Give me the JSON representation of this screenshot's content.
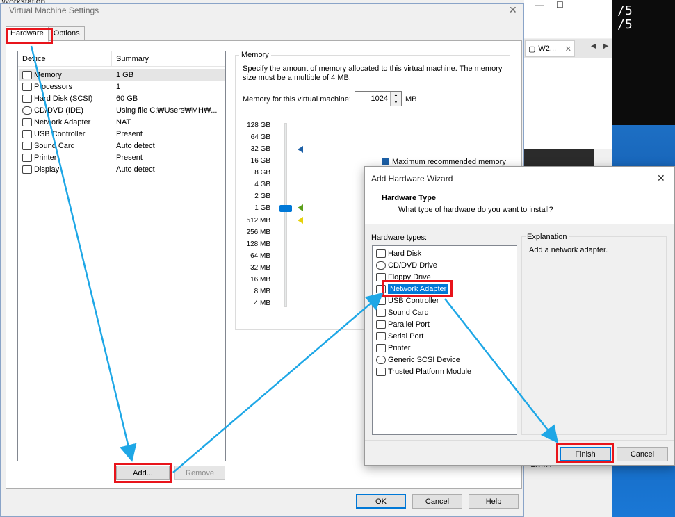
{
  "background": {
    "app_title": "Workstation",
    "console_lines": [
      "/5",
      "/5"
    ],
    "tab_label": "W2...",
    "file_hint": "-2.vmx"
  },
  "dialog": {
    "title": "Virtual Machine Settings",
    "tabs": [
      "Hardware",
      "Options"
    ],
    "device_header": "Device",
    "summary_header": "Summary",
    "devices": [
      {
        "name": "Memory",
        "summary": "1 GB",
        "icon": "memory-icon"
      },
      {
        "name": "Processors",
        "summary": "1",
        "icon": "processor-icon"
      },
      {
        "name": "Hard Disk (SCSI)",
        "summary": "60 GB",
        "icon": "hard-disk-icon"
      },
      {
        "name": "CD/DVD (IDE)",
        "summary": "Using file C:₩Users₩MH₩...",
        "icon": "cd-dvd-icon"
      },
      {
        "name": "Network Adapter",
        "summary": "NAT",
        "icon": "network-adapter-icon"
      },
      {
        "name": "USB Controller",
        "summary": "Present",
        "icon": "usb-icon"
      },
      {
        "name": "Sound Card",
        "summary": "Auto detect",
        "icon": "sound-icon"
      },
      {
        "name": "Printer",
        "summary": "Present",
        "icon": "printer-icon"
      },
      {
        "name": "Display",
        "summary": "Auto detect",
        "icon": "display-icon"
      }
    ],
    "add_label": "Add...",
    "remove_label": "Remove",
    "ok_label": "OK",
    "cancel_label": "Cancel",
    "help_label": "Help",
    "memory": {
      "group_label": "Memory",
      "description": "Specify the amount of memory allocated to this virtual machine. The memory size must be a multiple of 4 MB.",
      "for_label": "Memory for this virtual machine:",
      "value": "1024",
      "unit": "MB",
      "scale": [
        "128 GB",
        "64 GB",
        "32 GB",
        "16 GB",
        "8 GB",
        "4 GB",
        "2 GB",
        "1 GB",
        "512 MB",
        "256 MB",
        "128 MB",
        "64 MB",
        "32 MB",
        "16 MB",
        "8 MB",
        "4 MB"
      ],
      "max_recommended_label": "Maximum recommended memory",
      "colors": {
        "max_marker": "#1c5fa6",
        "recommended_marker": "#5a9e1a",
        "guest_marker": "#e6d10a"
      }
    }
  },
  "wizard": {
    "title": "Add Hardware Wizard",
    "heading": "Hardware Type",
    "subheading": "What type of hardware do you want to install?",
    "types_label": "Hardware types:",
    "types": [
      {
        "name": "Hard Disk",
        "icon": "hard-disk-icon"
      },
      {
        "name": "CD/DVD Drive",
        "icon": "cd-dvd-icon"
      },
      {
        "name": "Floppy Drive",
        "icon": "floppy-icon"
      },
      {
        "name": "Network Adapter",
        "icon": "network-adapter-icon"
      },
      {
        "name": "USB Controller",
        "icon": "usb-icon"
      },
      {
        "name": "Sound Card",
        "icon": "sound-icon"
      },
      {
        "name": "Parallel Port",
        "icon": "parallel-port-icon"
      },
      {
        "name": "Serial Port",
        "icon": "serial-port-icon"
      },
      {
        "name": "Printer",
        "icon": "printer-icon"
      },
      {
        "name": "Generic SCSI Device",
        "icon": "scsi-icon"
      },
      {
        "name": "Trusted Platform Module",
        "icon": "tpm-icon"
      }
    ],
    "explanation_label": "Explanation",
    "explanation": "Add a network adapter.",
    "finish_label": "Finish",
    "cancel_label": "Cancel"
  },
  "annotation_colors": {
    "highlight": "#e8141b",
    "arrow": "#1ea7e6"
  }
}
